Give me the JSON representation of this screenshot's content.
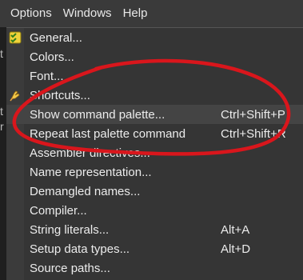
{
  "menubar": {
    "items": [
      {
        "label": "Options"
      },
      {
        "label": "Windows"
      },
      {
        "label": "Help"
      }
    ]
  },
  "left_strip": {
    "glyphs": [
      "t",
      "t",
      "r"
    ]
  },
  "menu": {
    "items": [
      {
        "label": "General...",
        "shortcut": "",
        "icon": "checklist-icon"
      },
      {
        "label": "Colors...",
        "shortcut": ""
      },
      {
        "label": "Font...",
        "shortcut": ""
      },
      {
        "label": "Shortcuts...",
        "shortcut": "",
        "icon": "hand-tool-icon"
      },
      {
        "label": "Show command palette...",
        "shortcut": "Ctrl+Shift+P"
      },
      {
        "label": "Repeat last palette command",
        "shortcut": "Ctrl+Shift+R"
      },
      {
        "label": "Assembler directives...",
        "shortcut": ""
      },
      {
        "label": "Name representation...",
        "shortcut": ""
      },
      {
        "label": "Demangled names...",
        "shortcut": ""
      },
      {
        "label": "Compiler...",
        "shortcut": ""
      },
      {
        "label": "String literals...",
        "shortcut": "Alt+A"
      },
      {
        "label": "Setup data types...",
        "shortcut": "Alt+D"
      },
      {
        "label": "Source paths...",
        "shortcut": ""
      }
    ]
  },
  "annotation": {
    "color": "#d9161c",
    "shape": "hand-drawn-ellipse"
  }
}
